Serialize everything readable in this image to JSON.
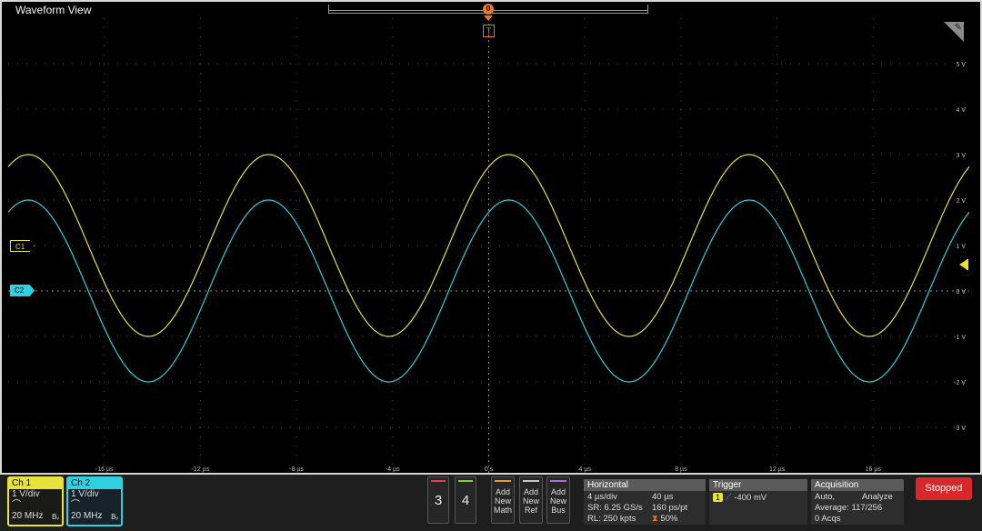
{
  "window": {
    "title": "Waveform View"
  },
  "markers": {
    "trigger_position": "0",
    "trigger_point": "T"
  },
  "axes": {
    "y_labels": [
      "5 V",
      "4 V",
      "3 V",
      "2 V",
      "1 V",
      "0 V",
      "-1 V",
      "-2 V",
      "-3 V"
    ],
    "x_labels": [
      "-16 µs",
      "-12 µs",
      "-8 µs",
      "-4 µs",
      "0 s",
      "4 µs",
      "8 µs",
      "12 µs",
      "16 µs"
    ]
  },
  "colors": {
    "ch1": "#e8e23c",
    "ch2": "#2fd0e0",
    "trigger": "#e87b22",
    "stopped": "#d7282b"
  },
  "chart_data": {
    "type": "line",
    "x_unit": "µs",
    "y_unit": "V",
    "xlim": [
      -20,
      20
    ],
    "ylim": [
      -4,
      6
    ],
    "grid": true,
    "series": [
      {
        "name": "C1",
        "amplitude": 2,
        "offset": 1,
        "period_us": 10,
        "phase_deg": 60
      },
      {
        "name": "C2",
        "amplitude": 2,
        "offset": 0,
        "period_us": 10,
        "phase_deg": 60
      }
    ]
  },
  "channel_handles": {
    "ch1": "C1",
    "ch2": "C2"
  },
  "ch1": {
    "label": "Ch 1",
    "scale": "1 V/div",
    "bandwidth": "20 MHz",
    "bw_suffix": "Bᵥ"
  },
  "ch2": {
    "label": "Ch 2",
    "scale": "1 V/div",
    "bandwidth": "20 MHz",
    "bw_suffix": "Bᵥ"
  },
  "buttons": {
    "ch3": "3",
    "ch4": "4",
    "add_math": [
      "Add",
      "New",
      "Math"
    ],
    "add_ref": [
      "Add",
      "New",
      "Ref"
    ],
    "add_bus": [
      "Add",
      "New",
      "Bus"
    ],
    "stopped": "Stopped"
  },
  "horizontal": {
    "title": "Horizontal",
    "scale": "4 µs/div",
    "position": "40 µs",
    "sample_rate": "SR: 6.25 GS/s",
    "resolution": "160 ps/pt",
    "record_length": "RL: 250 kpts",
    "delay": "50%"
  },
  "trigger": {
    "title": "Trigger",
    "source": "1",
    "level": "-400 mV"
  },
  "acquisition": {
    "title": "Acquisition",
    "mode": "Auto,",
    "analyze": "Analyze",
    "average": "Average: 117/256",
    "acqs": "0 Acqs"
  }
}
